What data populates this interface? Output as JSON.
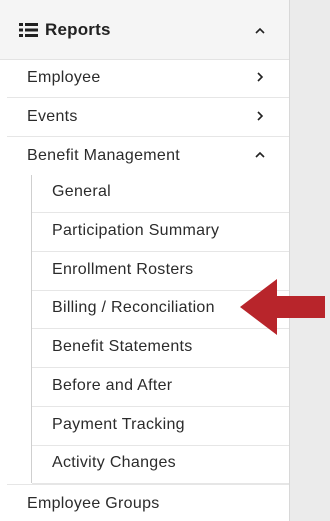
{
  "header": {
    "title": "Reports",
    "icon": "list-icon",
    "toggle_icon": "chevron-up-icon"
  },
  "menu": {
    "items": [
      {
        "label": "Employee",
        "icon": "chevron-right-icon"
      },
      {
        "label": "Events",
        "icon": "chevron-right-icon"
      },
      {
        "label": "Benefit Management",
        "icon": "chevron-up-icon"
      },
      {
        "label": "Employee Groups"
      }
    ],
    "benefit_management_children": [
      {
        "label": "General"
      },
      {
        "label": "Participation Summary"
      },
      {
        "label": "Enrollment Rosters"
      },
      {
        "label": "Billing / Reconciliation"
      },
      {
        "label": "Benefit Statements"
      },
      {
        "label": "Before and After"
      },
      {
        "label": "Payment Tracking"
      },
      {
        "label": "Activity Changes"
      }
    ]
  },
  "annotation": {
    "arrow_icon": "left-arrow-icon",
    "arrow_color": "#b8252b",
    "target": "Billing / Reconciliation"
  },
  "colors": {
    "panel_bg": "#ffffff",
    "header_bg": "#f5f5f5",
    "page_bg": "#ebebeb",
    "divider": "#e6e6e6"
  }
}
